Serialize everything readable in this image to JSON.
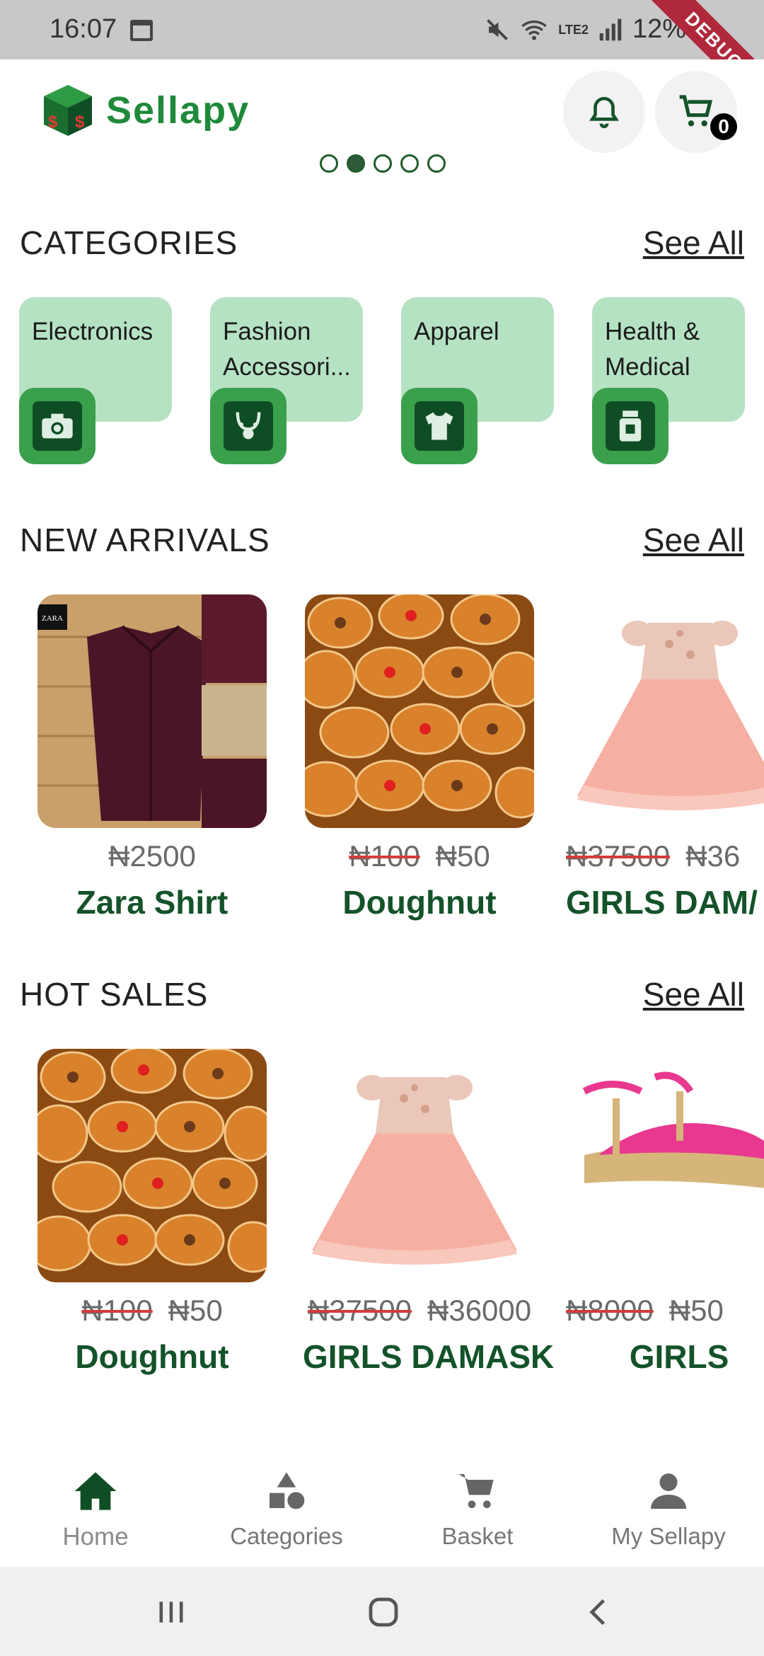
{
  "status_bar": {
    "time": "16:07",
    "battery": "12%",
    "network": "LTE2",
    "debug_ribbon": "DEBUG"
  },
  "header": {
    "brand": "Sellapy",
    "cart_count": "0"
  },
  "carousel": {
    "dot_count": 5,
    "active_index": 1
  },
  "categories": {
    "title": "CATEGORIES",
    "see_all": "See All",
    "items": [
      {
        "label": "Electronics",
        "icon": "camera-icon"
      },
      {
        "label": "Fashion Accessori...",
        "icon": "necklace-icon"
      },
      {
        "label": "Apparel",
        "icon": "shirt-icon"
      },
      {
        "label": "Health & Medical",
        "icon": "medicine-jar-icon"
      }
    ]
  },
  "new_arrivals": {
    "title": "NEW ARRIVALS",
    "see_all": "See All",
    "items": [
      {
        "name": "Zara Shirt",
        "old_price": "",
        "price": "₦2500",
        "image": "maroon-shirt"
      },
      {
        "name": "Doughnut",
        "old_price": "₦100",
        "price": "₦50",
        "image": "doughnuts"
      },
      {
        "name": "GIRLS DAM/",
        "old_price": "₦37500",
        "price": "₦36",
        "image": "pink-dress"
      }
    ]
  },
  "hot_sales": {
    "title": "HOT SALES",
    "see_all": "See All",
    "items": [
      {
        "name": "Doughnut",
        "old_price": "₦100",
        "price": "₦50",
        "image": "doughnuts"
      },
      {
        "name": "GIRLS DAMASK",
        "old_price": "₦37500",
        "price": "₦36000",
        "image": "pink-dress"
      },
      {
        "name": "GIRLS",
        "old_price": "₦8000",
        "price": "₦50",
        "image": "pink-sandals"
      }
    ]
  },
  "bottom_nav": {
    "items": [
      {
        "label": "Home",
        "icon": "home-icon",
        "active": true
      },
      {
        "label": "Categories",
        "icon": "shapes-icon",
        "active": false
      },
      {
        "label": "Basket",
        "icon": "cart-icon",
        "active": false
      },
      {
        "label": "My Sellapy",
        "icon": "person-icon",
        "active": false
      }
    ]
  },
  "colors": {
    "brand_green": "#1f8a3a",
    "dark_green": "#14532a",
    "category_bg": "#b6e2c4",
    "strike_red": "#d63b3b"
  }
}
